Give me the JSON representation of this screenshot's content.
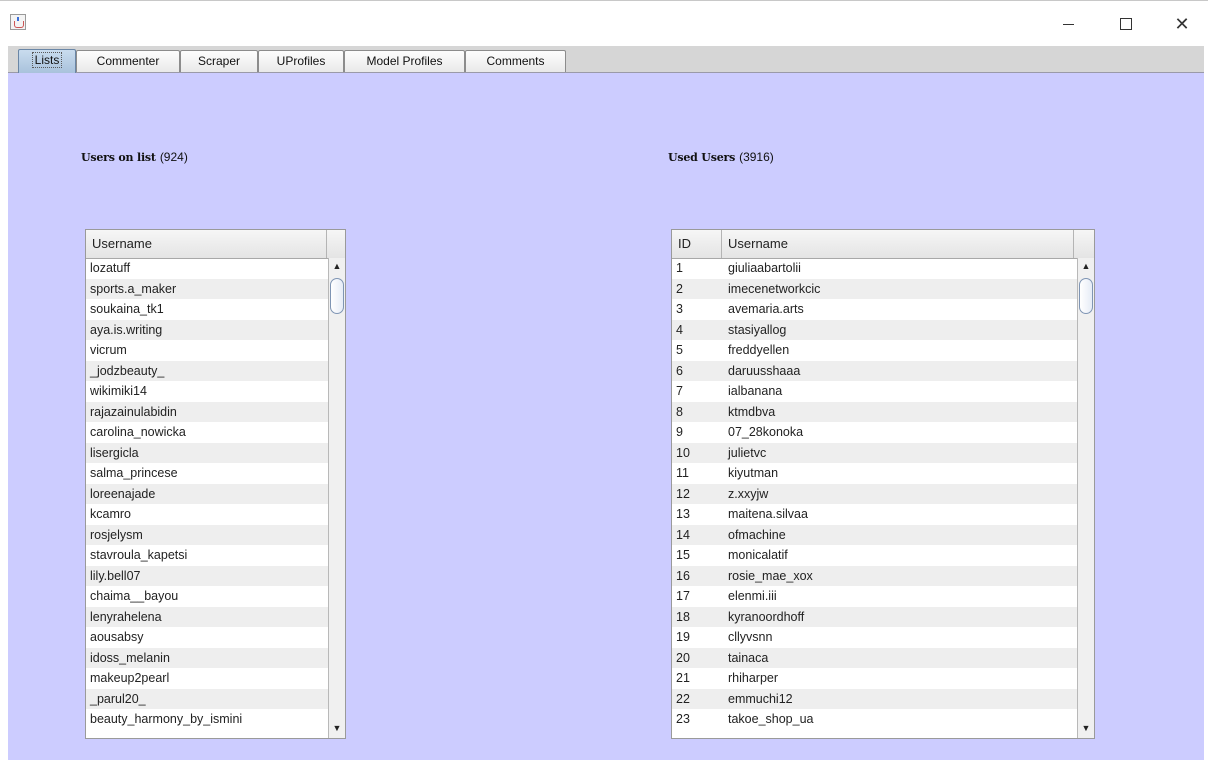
{
  "window": {
    "app_icon": "java-cup-icon",
    "controls": {
      "minimize": "—",
      "maximize": "☐",
      "close": "✕"
    }
  },
  "tabs": [
    "Lists",
    "Commenter",
    "Scraper",
    "UProfiles",
    "Model Profiles",
    "Comments"
  ],
  "active_tab": "Lists",
  "users_on_list": {
    "label": "Users on list",
    "count": "(924)",
    "column": "Username",
    "rows": [
      "lozatuff",
      "sports.a_maker",
      "soukaina_tk1",
      "aya.is.writing",
      "vicrum",
      "_jodzbeauty_",
      "wikimiki14",
      "rajazainulabidin",
      "carolina_nowicka",
      "lisergicla",
      "salma_princese",
      "loreenajade",
      "kcamro",
      "rosjelysm",
      "stavroula_kapetsi",
      "lily.bell07",
      "chaima__bayou",
      "lenyrahelena",
      "aousabsy",
      "idoss_melanin",
      "makeup2pearl",
      "_parul20_",
      "beauty_harmony_by_ismini"
    ]
  },
  "used_users": {
    "label": "Used Users",
    "count": "(3916)",
    "columns": [
      "ID",
      "Username"
    ],
    "rows": [
      [
        "1",
        "giuliaabartolii"
      ],
      [
        "2",
        "imecenetworkcic"
      ],
      [
        "3",
        "avemaria.arts"
      ],
      [
        "4",
        "stasiyallog"
      ],
      [
        "5",
        "freddyellen"
      ],
      [
        "6",
        "daruusshaaa"
      ],
      [
        "7",
        "ialbanana"
      ],
      [
        "8",
        "ktmdbva"
      ],
      [
        "9",
        "07_28konoka"
      ],
      [
        "10",
        "julietvc"
      ],
      [
        "11",
        "kiyutman"
      ],
      [
        "12",
        "z.xxyjw"
      ],
      [
        "13",
        "maitena.silvaa"
      ],
      [
        "14",
        "ofmachine"
      ],
      [
        "15",
        "monicalatif"
      ],
      [
        "16",
        "rosie_mae_xox"
      ],
      [
        "17",
        "elenmi.iii"
      ],
      [
        "18",
        "kyranoordhoff"
      ],
      [
        "19",
        "cllyvsnn"
      ],
      [
        "20",
        "tainaca"
      ],
      [
        "21",
        "rhiharper"
      ],
      [
        "22",
        "emmuchi12"
      ],
      [
        "23",
        "takoe_shop_ua"
      ]
    ]
  }
}
